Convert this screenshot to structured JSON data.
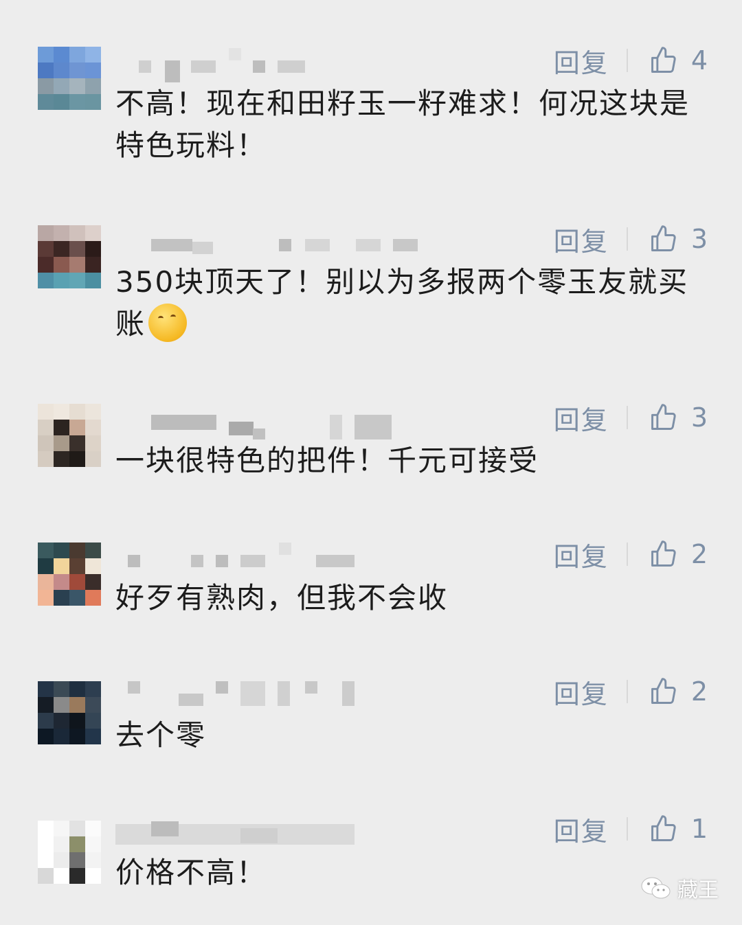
{
  "reply_label": "回复",
  "comments": [
    {
      "text": "不高！现在和田籽玉一籽难求！何况这块是特色玩料！",
      "likes": "4"
    },
    {
      "text": "350块顶天了！别以为多报两个零玉友就买账",
      "emoji": "thinking-face",
      "likes": "3"
    },
    {
      "text": "一块很特色的把件！千元可接受",
      "likes": "3"
    },
    {
      "text": "好歹有熟肉，但我不会收",
      "likes": "2"
    },
    {
      "text": "去个零",
      "likes": "2"
    },
    {
      "text": "价格不高！",
      "likes": "1"
    }
  ],
  "watermark": {
    "text": "藏王",
    "icon": "wechat-icon"
  },
  "colors": {
    "background": "#ededed",
    "action": "#7d8fa6",
    "text": "#1c1c1c"
  }
}
